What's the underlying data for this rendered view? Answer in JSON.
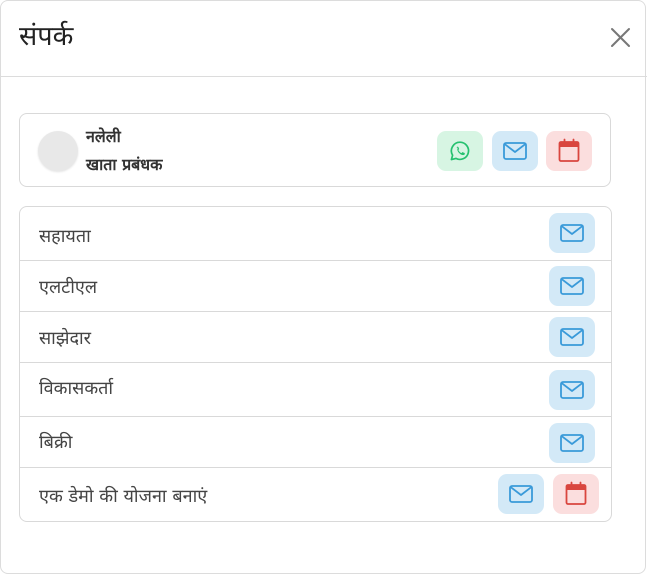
{
  "modal": {
    "title": "संपर्क",
    "close_icon": "close-icon"
  },
  "contact": {
    "name": "नलेली",
    "role": "खाता प्रबंधक",
    "actions": [
      {
        "icon": "whatsapp-icon",
        "color": "#25c16f"
      },
      {
        "icon": "mail-icon",
        "color": "#3a9ad9"
      },
      {
        "icon": "calendar-icon",
        "color": "#d9463f"
      }
    ]
  },
  "departments": [
    {
      "label": "सहायता",
      "actions": [
        "mail-icon"
      ]
    },
    {
      "label": "एलटीएल",
      "actions": [
        "mail-icon"
      ]
    },
    {
      "label": "साझेदार",
      "actions": [
        "mail-icon"
      ]
    },
    {
      "label": "विकासकर्ता",
      "actions": [
        "mail-icon"
      ]
    },
    {
      "label": "बिक्री",
      "actions": [
        "mail-icon"
      ]
    },
    {
      "label": "एक डेमो की योजना बनाएं",
      "actions": [
        "mail-icon",
        "calendar-icon"
      ]
    }
  ],
  "colors": {
    "whatsapp": "#25c16f",
    "mail": "#3a9ad9",
    "calendar": "#d9463f",
    "border": "#d9d9d9"
  }
}
